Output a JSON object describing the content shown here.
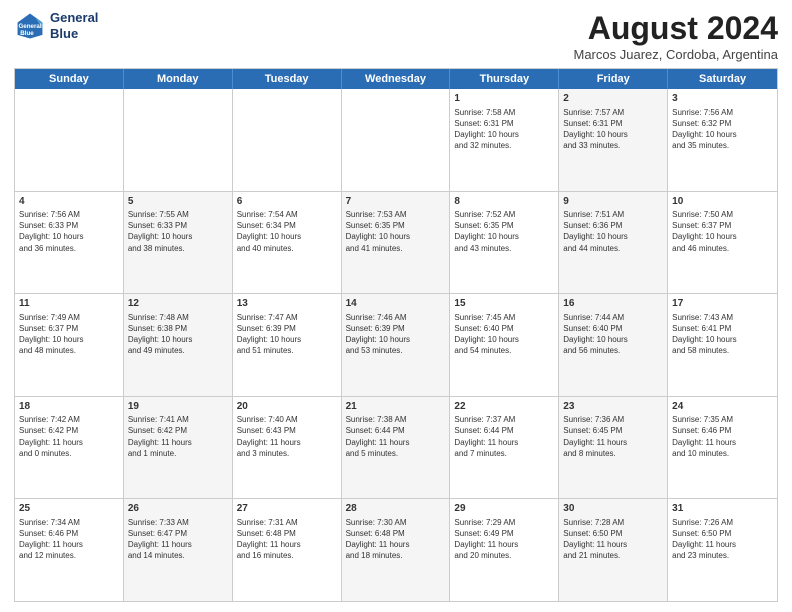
{
  "header": {
    "logo_line1": "General",
    "logo_line2": "Blue",
    "title": "August 2024",
    "subtitle": "Marcos Juarez, Cordoba, Argentina"
  },
  "days": [
    "Sunday",
    "Monday",
    "Tuesday",
    "Wednesday",
    "Thursday",
    "Friday",
    "Saturday"
  ],
  "weeks": [
    [
      {
        "num": "",
        "text": "",
        "shaded": false,
        "empty": true
      },
      {
        "num": "",
        "text": "",
        "shaded": false,
        "empty": true
      },
      {
        "num": "",
        "text": "",
        "shaded": false,
        "empty": true
      },
      {
        "num": "",
        "text": "",
        "shaded": false,
        "empty": true
      },
      {
        "num": "1",
        "text": "Sunrise: 7:58 AM\nSunset: 6:31 PM\nDaylight: 10 hours\nand 32 minutes.",
        "shaded": false
      },
      {
        "num": "2",
        "text": "Sunrise: 7:57 AM\nSunset: 6:31 PM\nDaylight: 10 hours\nand 33 minutes.",
        "shaded": true
      },
      {
        "num": "3",
        "text": "Sunrise: 7:56 AM\nSunset: 6:32 PM\nDaylight: 10 hours\nand 35 minutes.",
        "shaded": false
      }
    ],
    [
      {
        "num": "4",
        "text": "Sunrise: 7:56 AM\nSunset: 6:33 PM\nDaylight: 10 hours\nand 36 minutes.",
        "shaded": false
      },
      {
        "num": "5",
        "text": "Sunrise: 7:55 AM\nSunset: 6:33 PM\nDaylight: 10 hours\nand 38 minutes.",
        "shaded": true
      },
      {
        "num": "6",
        "text": "Sunrise: 7:54 AM\nSunset: 6:34 PM\nDaylight: 10 hours\nand 40 minutes.",
        "shaded": false
      },
      {
        "num": "7",
        "text": "Sunrise: 7:53 AM\nSunset: 6:35 PM\nDaylight: 10 hours\nand 41 minutes.",
        "shaded": true
      },
      {
        "num": "8",
        "text": "Sunrise: 7:52 AM\nSunset: 6:35 PM\nDaylight: 10 hours\nand 43 minutes.",
        "shaded": false
      },
      {
        "num": "9",
        "text": "Sunrise: 7:51 AM\nSunset: 6:36 PM\nDaylight: 10 hours\nand 44 minutes.",
        "shaded": true
      },
      {
        "num": "10",
        "text": "Sunrise: 7:50 AM\nSunset: 6:37 PM\nDaylight: 10 hours\nand 46 minutes.",
        "shaded": false
      }
    ],
    [
      {
        "num": "11",
        "text": "Sunrise: 7:49 AM\nSunset: 6:37 PM\nDaylight: 10 hours\nand 48 minutes.",
        "shaded": false
      },
      {
        "num": "12",
        "text": "Sunrise: 7:48 AM\nSunset: 6:38 PM\nDaylight: 10 hours\nand 49 minutes.",
        "shaded": true
      },
      {
        "num": "13",
        "text": "Sunrise: 7:47 AM\nSunset: 6:39 PM\nDaylight: 10 hours\nand 51 minutes.",
        "shaded": false
      },
      {
        "num": "14",
        "text": "Sunrise: 7:46 AM\nSunset: 6:39 PM\nDaylight: 10 hours\nand 53 minutes.",
        "shaded": true
      },
      {
        "num": "15",
        "text": "Sunrise: 7:45 AM\nSunset: 6:40 PM\nDaylight: 10 hours\nand 54 minutes.",
        "shaded": false
      },
      {
        "num": "16",
        "text": "Sunrise: 7:44 AM\nSunset: 6:40 PM\nDaylight: 10 hours\nand 56 minutes.",
        "shaded": true
      },
      {
        "num": "17",
        "text": "Sunrise: 7:43 AM\nSunset: 6:41 PM\nDaylight: 10 hours\nand 58 minutes.",
        "shaded": false
      }
    ],
    [
      {
        "num": "18",
        "text": "Sunrise: 7:42 AM\nSunset: 6:42 PM\nDaylight: 11 hours\nand 0 minutes.",
        "shaded": false
      },
      {
        "num": "19",
        "text": "Sunrise: 7:41 AM\nSunset: 6:42 PM\nDaylight: 11 hours\nand 1 minute.",
        "shaded": true
      },
      {
        "num": "20",
        "text": "Sunrise: 7:40 AM\nSunset: 6:43 PM\nDaylight: 11 hours\nand 3 minutes.",
        "shaded": false
      },
      {
        "num": "21",
        "text": "Sunrise: 7:38 AM\nSunset: 6:44 PM\nDaylight: 11 hours\nand 5 minutes.",
        "shaded": true
      },
      {
        "num": "22",
        "text": "Sunrise: 7:37 AM\nSunset: 6:44 PM\nDaylight: 11 hours\nand 7 minutes.",
        "shaded": false
      },
      {
        "num": "23",
        "text": "Sunrise: 7:36 AM\nSunset: 6:45 PM\nDaylight: 11 hours\nand 8 minutes.",
        "shaded": true
      },
      {
        "num": "24",
        "text": "Sunrise: 7:35 AM\nSunset: 6:46 PM\nDaylight: 11 hours\nand 10 minutes.",
        "shaded": false
      }
    ],
    [
      {
        "num": "25",
        "text": "Sunrise: 7:34 AM\nSunset: 6:46 PM\nDaylight: 11 hours\nand 12 minutes.",
        "shaded": false
      },
      {
        "num": "26",
        "text": "Sunrise: 7:33 AM\nSunset: 6:47 PM\nDaylight: 11 hours\nand 14 minutes.",
        "shaded": true
      },
      {
        "num": "27",
        "text": "Sunrise: 7:31 AM\nSunset: 6:48 PM\nDaylight: 11 hours\nand 16 minutes.",
        "shaded": false
      },
      {
        "num": "28",
        "text": "Sunrise: 7:30 AM\nSunset: 6:48 PM\nDaylight: 11 hours\nand 18 minutes.",
        "shaded": true
      },
      {
        "num": "29",
        "text": "Sunrise: 7:29 AM\nSunset: 6:49 PM\nDaylight: 11 hours\nand 20 minutes.",
        "shaded": false
      },
      {
        "num": "30",
        "text": "Sunrise: 7:28 AM\nSunset: 6:50 PM\nDaylight: 11 hours\nand 21 minutes.",
        "shaded": true
      },
      {
        "num": "31",
        "text": "Sunrise: 7:26 AM\nSunset: 6:50 PM\nDaylight: 11 hours\nand 23 minutes.",
        "shaded": false
      }
    ]
  ]
}
